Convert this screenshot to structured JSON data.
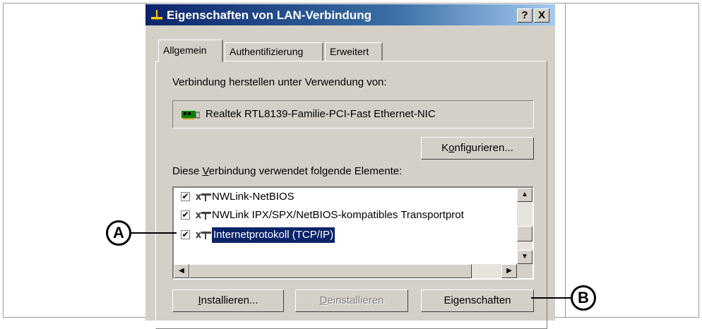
{
  "dialog": {
    "title": "Eigenschaften von LAN-Verbindung",
    "help_button": "?",
    "close_button": "X",
    "tabs": [
      {
        "label": "Allgemein",
        "active": true
      },
      {
        "label": "Authentifizierung",
        "active": false
      },
      {
        "label": "Erweitert",
        "active": false
      }
    ],
    "connect_using_label": "Verbindung herstellen unter Verwendung von:",
    "adapter_name": "Realtek RTL8139-Familie-PCI-Fast Ethernet-NIC",
    "configure_button": {
      "pre": "K",
      "u": "o",
      "post": "nfigurieren..."
    },
    "components_label": {
      "pre": "Diese ",
      "u": "V",
      "post": "erbindung verwendet folgende Elemente:"
    },
    "components": [
      {
        "label": "NWLink-NetBIOS",
        "checked": true,
        "selected": false
      },
      {
        "label": "NWLink IPX/SPX/NetBIOS-kompatibles Transportprot",
        "checked": true,
        "selected": false
      },
      {
        "label": "Internetprotokoll (TCP/IP)",
        "checked": true,
        "selected": true
      }
    ],
    "install_button": {
      "pre": "",
      "u": "I",
      "post": "nstallieren..."
    },
    "uninstall_button": {
      "pre": "",
      "u": "D",
      "post": "einstallieren"
    },
    "properties_button": {
      "pre": "Ei",
      "u": "g",
      "post": "enschaften"
    }
  },
  "callouts": {
    "a": "A",
    "b": "B"
  }
}
